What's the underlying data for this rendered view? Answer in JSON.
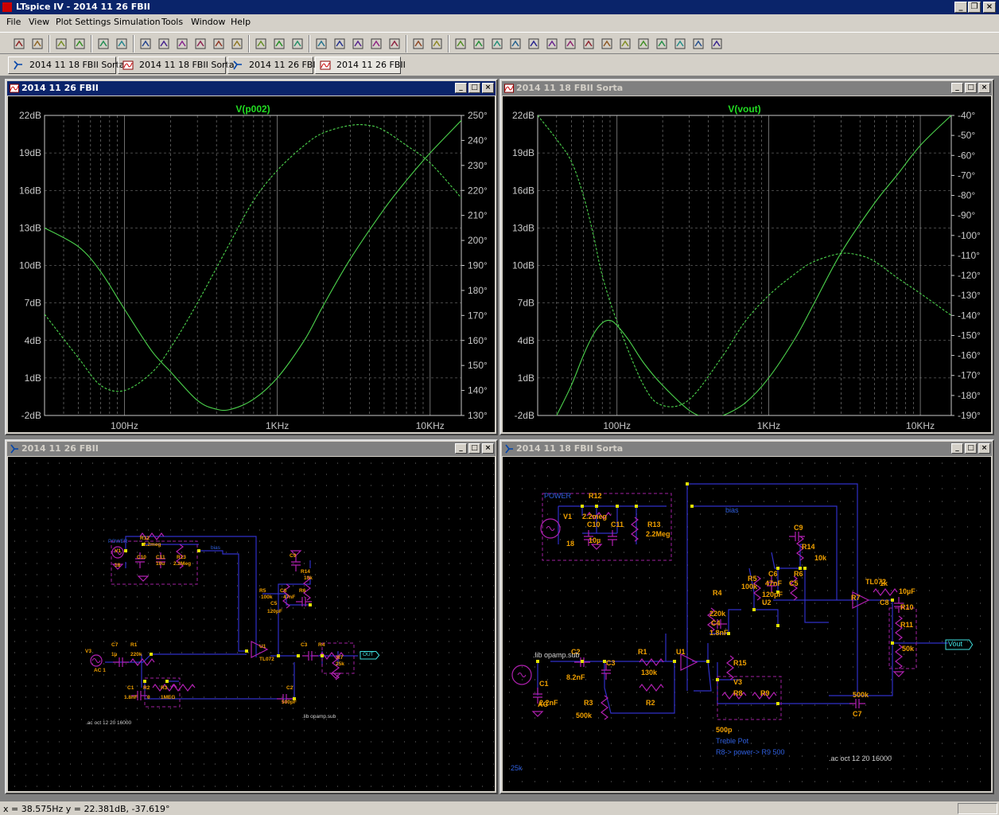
{
  "app": {
    "title": "LTspice IV - 2014 11 26 FBII"
  },
  "menu": [
    "File",
    "View",
    "Plot Settings",
    "Simulation",
    "Tools",
    "Window",
    "Help"
  ],
  "toolbar": {
    "icons": [
      "new-schematic-icon",
      "open-icon",
      "save-icon",
      "control-panel-icon",
      "run-icon",
      "halt-icon",
      "zoom-in-icon",
      "zoom-out-icon",
      "zoom-fit-icon",
      "zoom-cancel-icon",
      "autorange-icon",
      "full-range-icon",
      "tile-icon",
      "cascade-icon",
      "close-windows-icon",
      "cut-icon",
      "copy-icon",
      "paste-icon",
      "find-icon",
      "print-setup-icon",
      "print-icon",
      "wire-icon",
      "ground-icon",
      "label-icon",
      "resistor-icon",
      "capacitor-icon",
      "inductor-icon",
      "diode-icon",
      "component-icon",
      "move-icon",
      "drag-icon",
      "undo-icon",
      "redo-icon",
      "rotate-icon",
      "mirror-icon",
      "text-icon",
      "spice-directive-icon"
    ]
  },
  "tabs": [
    {
      "label": "2014 11 18 FBII Sorta",
      "icon": "schematic-icon"
    },
    {
      "label": "2014 11 18 FBII Sorta",
      "icon": "waveform-icon"
    },
    {
      "label": "2014 11 26 FBII",
      "icon": "schematic-icon"
    },
    {
      "label": "2014 11 26 FBII",
      "icon": "waveform-icon",
      "active": true
    }
  ],
  "windows": {
    "plot_left": {
      "title": "2014 11 26 FBII",
      "active": true
    },
    "plot_right": {
      "title": "2014 11 18 FBII Sorta",
      "active": false
    },
    "sch_left": {
      "title": "2014 11 26 FBII",
      "active": false
    },
    "sch_right": {
      "title": "2014 11 18 FBII Sorta",
      "active": false
    }
  },
  "chart_data": [
    {
      "type": "line",
      "title": "V(p002)",
      "x_scale": "log",
      "xlim": [
        30,
        16000
      ],
      "xticks": [
        "100Hz",
        "1KHz",
        "10KHz"
      ],
      "ylim": [
        -2,
        22
      ],
      "yticks": [
        "22dB",
        "19dB",
        "16dB",
        "13dB",
        "10dB",
        "7dB",
        "4dB",
        "1dB",
        "-2dB"
      ],
      "y2lim": [
        130,
        250
      ],
      "y2ticks": [
        "250°",
        "240°",
        "230°",
        "220°",
        "210°",
        "200°",
        "190°",
        "180°",
        "170°",
        "160°",
        "150°",
        "140°",
        "130°"
      ],
      "grid": true,
      "series": [
        {
          "kind": "magnitude (dB)",
          "style": "solid",
          "color": "#4cd34c",
          "x": [
            30,
            50,
            70,
            100,
            150,
            200,
            300,
            400,
            500,
            700,
            1000,
            1500,
            2000,
            3000,
            5000,
            7000,
            10000,
            16000
          ],
          "y": [
            13.0,
            11.5,
            9.5,
            6.5,
            3.2,
            1.5,
            -0.8,
            -1.5,
            -1.5,
            -0.7,
            1.0,
            4.0,
            6.8,
            10.5,
            14.5,
            16.8,
            19.0,
            21.6
          ]
        },
        {
          "kind": "phase (°)",
          "style": "dashed",
          "color": "#4cd34c",
          "x": [
            30,
            50,
            70,
            100,
            150,
            200,
            300,
            500,
            700,
            1000,
            1500,
            2000,
            3000,
            4000,
            5000,
            7000,
            10000,
            16000
          ],
          "y": [
            170.5,
            153,
            142,
            140,
            147,
            157,
            175,
            200,
            216,
            228,
            238,
            243,
            246,
            246,
            244,
            238,
            231,
            217
          ]
        }
      ]
    },
    {
      "type": "line",
      "title": "V(vout)",
      "x_scale": "log",
      "xlim": [
        30,
        16000
      ],
      "xticks": [
        "100Hz",
        "1KHz",
        "10KHz"
      ],
      "ylim": [
        -2,
        22
      ],
      "yticks": [
        "22dB",
        "19dB",
        "16dB",
        "13dB",
        "10dB",
        "7dB",
        "4dB",
        "1dB",
        "-2dB"
      ],
      "y2lim": [
        -190,
        -40
      ],
      "y2ticks": [
        "-40°",
        "-50°",
        "-60°",
        "-70°",
        "-80°",
        "-90°",
        "-100°",
        "-110°",
        "-120°",
        "-130°",
        "-140°",
        "-150°",
        "-160°",
        "-170°",
        "-180°",
        "-190°"
      ],
      "grid": true,
      "series": [
        {
          "kind": "magnitude (dB)",
          "style": "solid",
          "color": "#4cd34c",
          "x": [
            40,
            50,
            60,
            70,
            80,
            90,
            100,
            120,
            150,
            200,
            300,
            400,
            500,
            700,
            1000,
            1500,
            2000,
            3000,
            5000,
            7000,
            10000,
            16000
          ],
          "y": [
            -2,
            0.4,
            2.8,
            4.5,
            5.4,
            5.6,
            5.2,
            4,
            2.2,
            0.4,
            -1.6,
            -2.2,
            -2,
            -1,
            1,
            4.2,
            7,
            11,
            15,
            17.2,
            19.6,
            22
          ]
        },
        {
          "kind": "phase (°)",
          "style": "dashed",
          "color": "#4cd34c",
          "x": [
            30,
            40,
            50,
            60,
            70,
            80,
            100,
            150,
            200,
            300,
            500,
            700,
            1000,
            1500,
            2000,
            3000,
            4000,
            5000,
            7000,
            10000,
            16000
          ],
          "y": [
            -40,
            -52,
            -63,
            -80,
            -100,
            -120,
            -143,
            -175,
            -185,
            -182,
            -160,
            -143,
            -130,
            -119,
            -113,
            -109,
            -110,
            -113,
            -121,
            -129,
            -140
          ]
        }
      ]
    }
  ],
  "schematic_left": {
    "labels": [
      {
        "t": "POWER",
        "c": "blue"
      },
      {
        "t": "R12",
        "c": "orange"
      },
      {
        "t": "V1",
        "c": "orange"
      },
      {
        "t": "2.2meg",
        "c": "orange"
      },
      {
        "t": "C10",
        "c": "orange"
      },
      {
        "t": "C11",
        "c": "orange"
      },
      {
        "t": "R13",
        "c": "orange"
      },
      {
        "t": "10u",
        "c": "orange"
      },
      {
        "t": "2.2Meg",
        "c": "orange"
      },
      {
        "t": "18",
        "c": "orange"
      },
      {
        "t": "bias",
        "c": "blue"
      },
      {
        "t": "C9",
        "c": "orange"
      },
      {
        "t": "R14",
        "c": "orange"
      },
      {
        "t": "10k",
        "c": "orange"
      },
      {
        "t": "R5",
        "c": "orange"
      },
      {
        "t": "C6",
        "c": "orange"
      },
      {
        "t": "R6",
        "c": "orange"
      },
      {
        "t": "100k",
        "c": "orange"
      },
      {
        "t": "47nF",
        "c": "orange"
      },
      {
        "t": "C5",
        "c": "orange"
      },
      {
        "t": "120pF",
        "c": "orange"
      },
      {
        "t": "V3",
        "c": "orange"
      },
      {
        "t": "C7",
        "c": "orange"
      },
      {
        "t": "R1",
        "c": "orange"
      },
      {
        "t": "1µ",
        "c": "orange"
      },
      {
        "t": "220k",
        "c": "orange"
      },
      {
        "t": "U1",
        "c": "orange"
      },
      {
        "t": "TL072",
        "c": "orange"
      },
      {
        "t": "C3",
        "c": "orange"
      },
      {
        "t": "R4",
        "c": "orange"
      },
      {
        "t": "R7",
        "c": "orange"
      },
      {
        "t": "25k",
        "c": "orange"
      },
      {
        "t": "AC 1",
        "c": "orange"
      },
      {
        "t": "C1",
        "c": "orange"
      },
      {
        "t": "R2",
        "c": "orange"
      },
      {
        "t": "R3",
        "c": "orange"
      },
      {
        "t": "C2",
        "c": "orange"
      },
      {
        "t": "1.8nF",
        "c": "orange"
      },
      {
        "t": "0",
        "c": "orange"
      },
      {
        "t": "1MEG",
        "c": "orange"
      },
      {
        "t": "500pF",
        "c": "orange"
      },
      {
        "t": ".ac oct 12 20 16000",
        "c": "white"
      },
      {
        "t": ".lib opamp.sub",
        "c": "white"
      },
      {
        "t": "OUT",
        "c": "cyan"
      }
    ]
  },
  "schematic_right": {
    "labels": [
      {
        "t": "POWER",
        "c": "blue"
      },
      {
        "t": "R12",
        "c": "orange"
      },
      {
        "t": "V1",
        "c": "orange"
      },
      {
        "t": "2.2meg",
        "c": "orange"
      },
      {
        "t": "C10",
        "c": "orange"
      },
      {
        "t": "C11",
        "c": "orange"
      },
      {
        "t": "R13",
        "c": "orange"
      },
      {
        "t": "10µ",
        "c": "orange"
      },
      {
        "t": "2.2Meg",
        "c": "orange"
      },
      {
        "t": "18",
        "c": "orange"
      },
      {
        "t": "bias",
        "c": "blue"
      },
      {
        "t": "C9",
        "c": "orange"
      },
      {
        "t": "R14",
        "c": "orange"
      },
      {
        "t": "10k",
        "c": "orange"
      },
      {
        "t": "R5",
        "c": "orange"
      },
      {
        "t": "C6",
        "c": "orange"
      },
      {
        "t": "R6",
        "c": "orange"
      },
      {
        "t": "100k",
        "c": "orange"
      },
      {
        "t": "47nF",
        "c": "orange"
      },
      {
        "t": "C5",
        "c": "orange"
      },
      {
        "t": "120pF",
        "c": "orange"
      },
      {
        "t": "U2",
        "c": "orange"
      },
      {
        "t": "TL072",
        "c": "orange"
      },
      {
        "t": "R7",
        "c": "orange"
      },
      {
        "t": "1k",
        "c": "orange"
      },
      {
        "t": "C8",
        "c": "orange"
      },
      {
        "t": "10µF",
        "c": "orange"
      },
      {
        "t": "R10",
        "c": "orange"
      },
      {
        "t": "R11",
        "c": "orange"
      },
      {
        "t": "50k",
        "c": "orange"
      },
      {
        "t": "Vout",
        "c": "cyan"
      },
      {
        "t": "R4",
        "c": "orange"
      },
      {
        "t": "220k",
        "c": "orange"
      },
      {
        "t": "C4",
        "c": "orange"
      },
      {
        "t": "1.8nF",
        "c": "orange"
      },
      {
        "t": "R15",
        "c": "orange"
      },
      {
        "t": "C2",
        "c": "orange"
      },
      {
        "t": "C3",
        "c": "orange"
      },
      {
        "t": "R1",
        "c": "orange"
      },
      {
        "t": "8.2nF",
        "c": "orange"
      },
      {
        "t": "130k",
        "c": "orange"
      },
      {
        "t": "R2",
        "c": "orange"
      },
      {
        "t": "U1",
        "c": "orange"
      },
      {
        "t": "C1",
        "c": "orange"
      },
      {
        "t": "2.2nF",
        "c": "orange"
      },
      {
        "t": "AC",
        "c": "orange"
      },
      {
        "t": "R3",
        "c": "orange"
      },
      {
        "t": "500k",
        "c": "orange"
      },
      {
        "t": "R8",
        "c": "orange"
      },
      {
        "t": "R9",
        "c": "orange"
      },
      {
        "t": "500k",
        "c": "orange"
      },
      {
        "t": "C7",
        "c": "orange"
      },
      {
        "t": "500p",
        "c": "orange"
      },
      {
        "t": "Treble Pot",
        "c": "blue"
      },
      {
        "t": "R8-> power-> R9 500",
        "c": "blue"
      },
      {
        "t": "25k",
        "c": "blue"
      },
      {
        "t": ".ac oct 12 20 16000",
        "c": "white"
      },
      {
        "t": ".lib opamp.sub",
        "c": "white"
      },
      {
        "t": "V3",
        "c": "orange"
      },
      {
        "t": "0",
        "c": "orange"
      }
    ]
  },
  "status": {
    "text": "x = 38.575Hz    y = 22.381dB, -37.619°"
  }
}
